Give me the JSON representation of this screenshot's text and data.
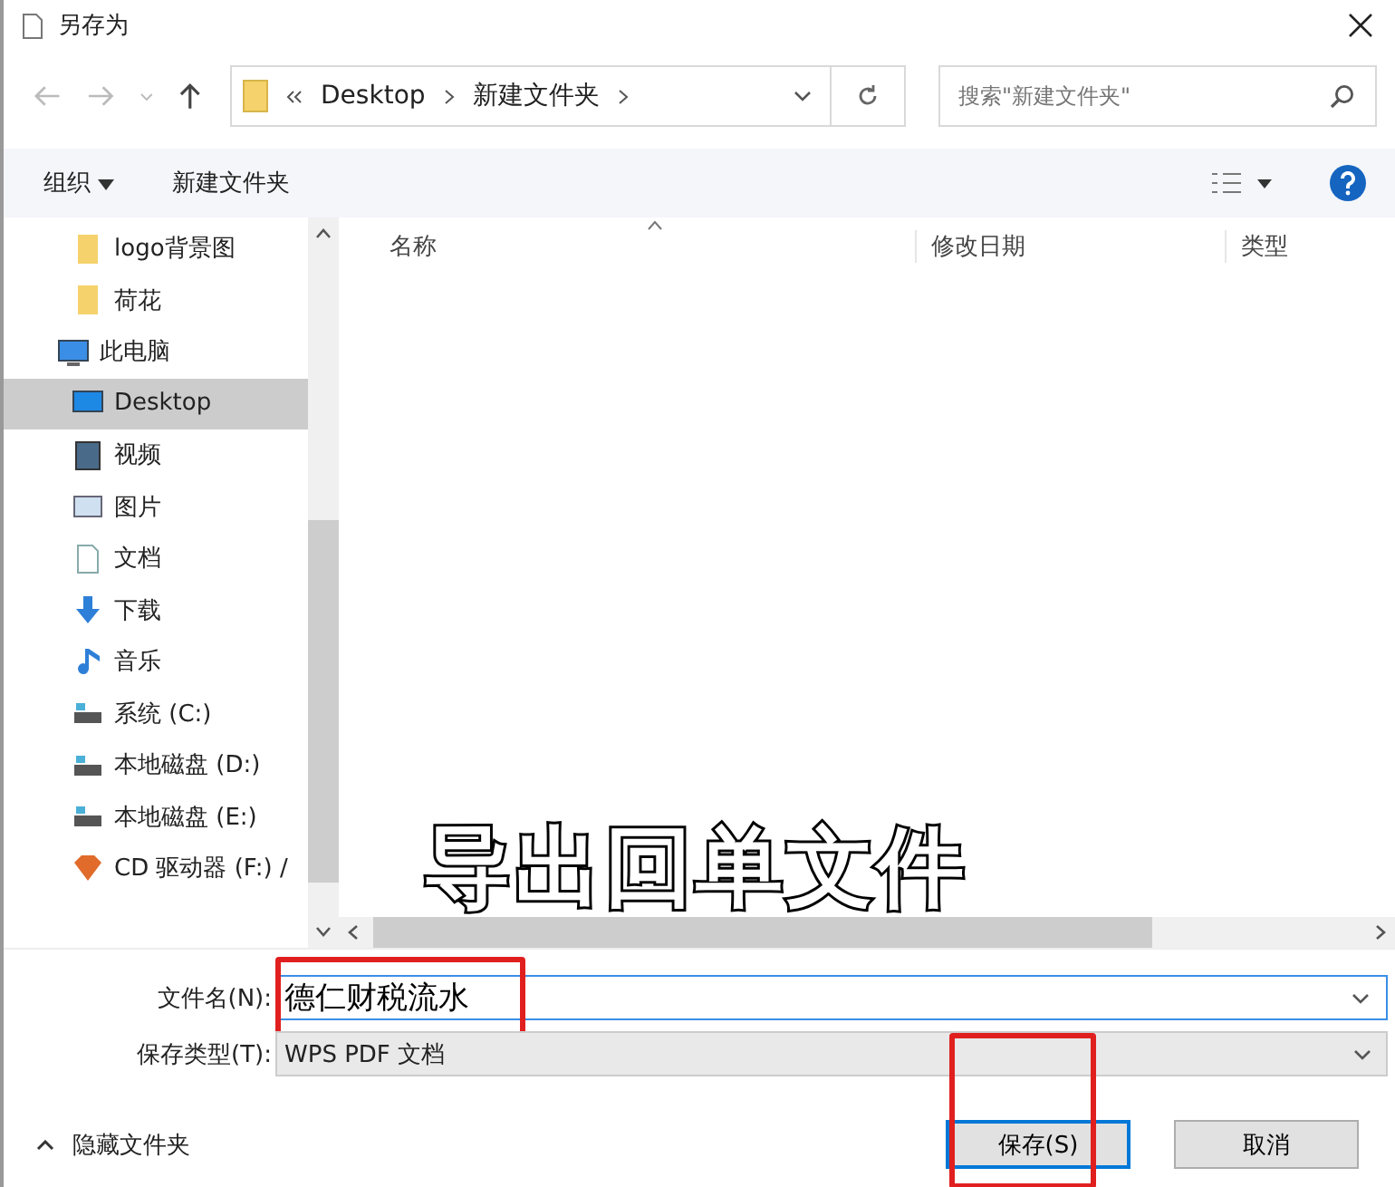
{
  "window": {
    "title": "另存为"
  },
  "address": {
    "crumbs": [
      "Desktop",
      "新建文件夹"
    ],
    "search_placeholder": "搜索\"新建文件夹\""
  },
  "toolbar": {
    "organize": "组织",
    "new_folder": "新建文件夹"
  },
  "sidebar": {
    "items": [
      {
        "label": "logo背景图",
        "kind": "folder",
        "selected": false
      },
      {
        "label": "荷花",
        "kind": "folder",
        "selected": false
      },
      {
        "label": "此电脑",
        "kind": "pc",
        "selected": false,
        "children": [
          {
            "label": "Desktop",
            "kind": "desktop",
            "selected": true
          },
          {
            "label": "视频",
            "kind": "video",
            "selected": false
          },
          {
            "label": "图片",
            "kind": "picture",
            "selected": false
          },
          {
            "label": "文档",
            "kind": "document",
            "selected": false
          },
          {
            "label": "下载",
            "kind": "download",
            "selected": false
          },
          {
            "label": "音乐",
            "kind": "music",
            "selected": false
          },
          {
            "label": "系统 (C:)",
            "kind": "drive",
            "selected": false
          },
          {
            "label": "本地磁盘 (D:)",
            "kind": "drive",
            "selected": false
          },
          {
            "label": "本地磁盘 (E:)",
            "kind": "drive",
            "selected": false
          },
          {
            "label": "CD 驱动器 (F:) /",
            "kind": "cd",
            "selected": false
          }
        ]
      }
    ]
  },
  "table": {
    "columns": [
      "名称",
      "修改日期",
      "类型"
    ]
  },
  "form": {
    "filename_label": "文件名(N):",
    "filename": "德仁财税流水",
    "filename_highlighted": true,
    "type_label": "保存类型(T):",
    "type": "WPS PDF 文档"
  },
  "footer": {
    "hide_folders": "隐藏文件夹",
    "buttons": [
      {
        "label": "保存(S)",
        "kind": "primary",
        "highlighted": true
      },
      {
        "label": "取消",
        "kind": "normal",
        "highlighted": false
      }
    ]
  },
  "caption": "导出回单文件"
}
